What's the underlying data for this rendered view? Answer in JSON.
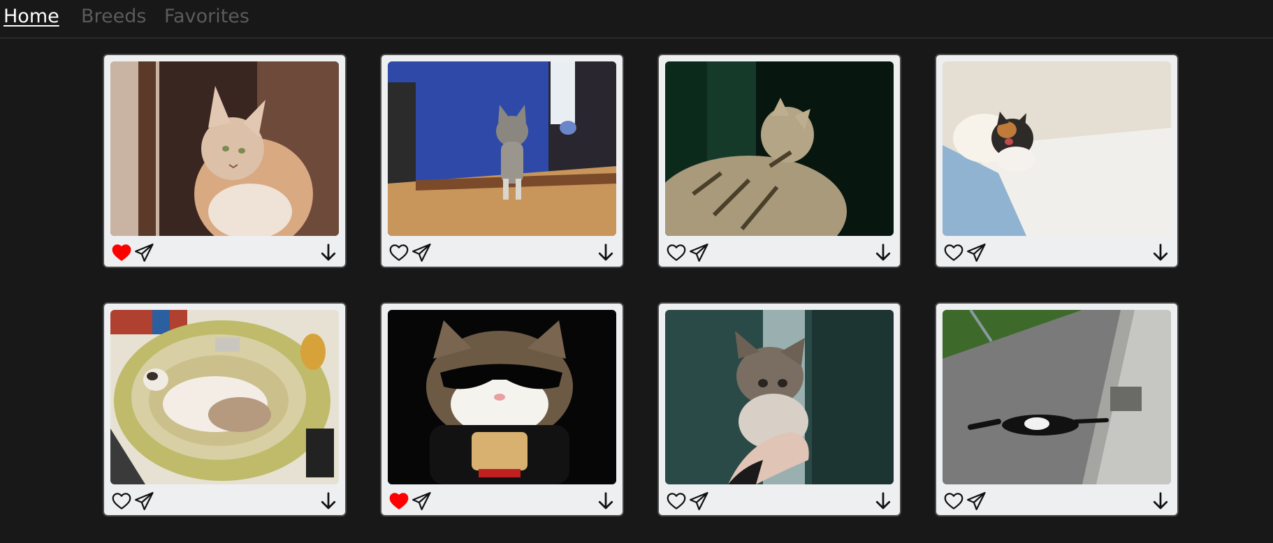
{
  "nav": {
    "items": [
      {
        "label": "Home",
        "active": true
      },
      {
        "label": "Breeds",
        "active": false
      },
      {
        "label": "Favorites",
        "active": false
      }
    ]
  },
  "colors": {
    "background": "#181818",
    "card": "#eeeff1",
    "favorite_active": "#ff0000",
    "nav_active": "#ffffff",
    "nav_inactive": "#5b5b5b"
  },
  "icons": {
    "favorite": "heart-icon",
    "share": "send-icon",
    "download": "arrow-down-icon"
  },
  "cats": [
    {
      "favorited": true
    },
    {
      "favorited": false
    },
    {
      "favorited": false
    },
    {
      "favorited": false
    },
    {
      "favorited": false
    },
    {
      "favorited": true
    },
    {
      "favorited": false
    },
    {
      "favorited": false
    }
  ]
}
